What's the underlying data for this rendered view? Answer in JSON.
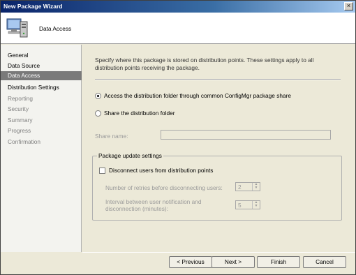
{
  "window": {
    "title": "New Package Wizard",
    "close_glyph": "×"
  },
  "header": {
    "title": "Data Access",
    "icon": "computer-network-icon"
  },
  "nav": {
    "items": [
      {
        "label": "General",
        "state": "normal"
      },
      {
        "label": "Data Source",
        "state": "normal"
      },
      {
        "label": "Data Access",
        "state": "active"
      },
      {
        "label": "Distribution Settings",
        "state": "normal"
      },
      {
        "label": "Reporting",
        "state": "dim"
      },
      {
        "label": "Security",
        "state": "dim"
      },
      {
        "label": "Summary",
        "state": "dim"
      },
      {
        "label": "Progress",
        "state": "dim"
      },
      {
        "label": "Confirmation",
        "state": "dim"
      }
    ]
  },
  "content": {
    "description": "Specify where this package is stored on distribution points. These settings apply to all distribution points receiving the package.",
    "radio_access": "Access the distribution folder through common ConfigMgr package share",
    "radio_share": "Share the distribution folder",
    "share_name_label": "Share name:",
    "share_name_value": "",
    "group_title": "Package update settings",
    "disconnect_label": "Disconnect users from distribution points",
    "retries_label": "Number of retries before disconnecting users:",
    "retries_value": "2",
    "interval_label_1": "Interval between user notification and",
    "interval_label_2": "disconnection (minutes):",
    "interval_value": "5"
  },
  "buttons": {
    "previous": "< Previous",
    "next": "Next >",
    "finish": "Finish",
    "cancel": "Cancel"
  }
}
